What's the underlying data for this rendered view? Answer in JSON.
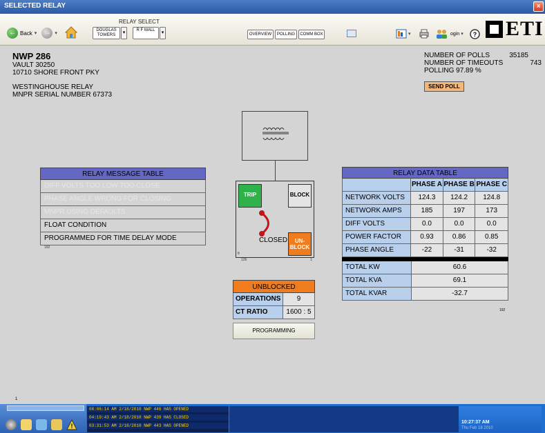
{
  "window": {
    "title": "SELECTED RELAY",
    "close_glyph": "×"
  },
  "toolbar": {
    "back_label": "Back",
    "relay_select_label": "RELAY SELECT",
    "relay_1": "DOUGLAS TOWERS",
    "relay_2": "R F MALL",
    "overview": "OVERVIEW",
    "polling": "POLLING",
    "comm_box": "COMM BOX",
    "login_label": "ogin",
    "logo_text": "ETI"
  },
  "vault": {
    "name": "NWP 286",
    "vault": "VAULT 30250",
    "address": "10710 SHORE FRONT PKY",
    "relay_type": "WESTINGHOUSE RELAY",
    "serial": "MNPR SERIAL NUMBER  67373"
  },
  "polls": {
    "polls_label": "NUMBER OF POLLS",
    "polls_value": "35185",
    "timeouts_label": "NUMBER OF TIMEOUTS",
    "timeouts_value": "743",
    "polling_text": "POLLING  97.89 %",
    "send_poll": "SEND POLL"
  },
  "message_table": {
    "title": "RELAY MESSAGE TABLE",
    "rows": [
      "DIFF VOLTS TOO LOW TOO CLOSE",
      "PHASE ANGLE WRONG FOR CLOSING",
      "MNPR USING DEFAULTS",
      "FLOAT CONDITION",
      "PROGRAMMED FOR TIME DELAY MODE"
    ],
    "footnote": "192"
  },
  "relay": {
    "trip": "TRIP",
    "block": "BLOCK",
    "closed": "CLOSED",
    "unblock_1": "UN-",
    "unblock_2": "BLOCK",
    "corner_8": "8",
    "corner_1": "1",
    "corner_126": "126"
  },
  "status": {
    "state": "UNBLOCKED",
    "operations_label": "OPERATIONS",
    "operations_value": "9",
    "ct_label": "CT RATIO",
    "ct_value": "1600 : 5",
    "programming": "PROGRAMMING"
  },
  "data_table": {
    "title": "RELAY DATA TABLE",
    "phase_headers": [
      "PHASE A",
      "PHASE B",
      "PHASE C"
    ],
    "rows": [
      {
        "label": "NETWORK VOLTS",
        "a": "124.3",
        "b": "124.2",
        "c": "124.8"
      },
      {
        "label": "NETWORK AMPS",
        "a": "185",
        "b": "197",
        "c": "173"
      },
      {
        "label": "DIFF VOLTS",
        "a": "0.0",
        "b": "0.0",
        "c": "0.0"
      },
      {
        "label": "POWER FACTOR",
        "a": "0.93",
        "b": "0.86",
        "c": "0.85"
      },
      {
        "label": "PHASE ANGLE",
        "a": "-22",
        "b": "-31",
        "c": "-32"
      }
    ],
    "totals": [
      {
        "label": "TOTAL KW",
        "value": "60.6"
      },
      {
        "label": "TOTAL KVA",
        "value": "69.1"
      },
      {
        "label": "TOTAL KVAR",
        "value": "-32.7"
      }
    ],
    "footnote": "192"
  },
  "corner_number": "1",
  "taskbar": {
    "messages": [
      "08:06:14 AM  2/18/2010   NWP 446 HAS OPENED",
      "04:19:43 AM  2/18/2010   NWP 439 HAS CLOSED",
      "03:31:53 AM  2/18/2010   NWP 443 HAS OPENED"
    ],
    "time": "10:27:37 AM",
    "date": "Thu Feb 18 2010"
  },
  "colors": {
    "table_header": "#6468c4",
    "label_cell": "#b8d0ec",
    "trip": "#2db34a",
    "unblock": "#f07c1e",
    "send_poll": "#f2b879"
  }
}
